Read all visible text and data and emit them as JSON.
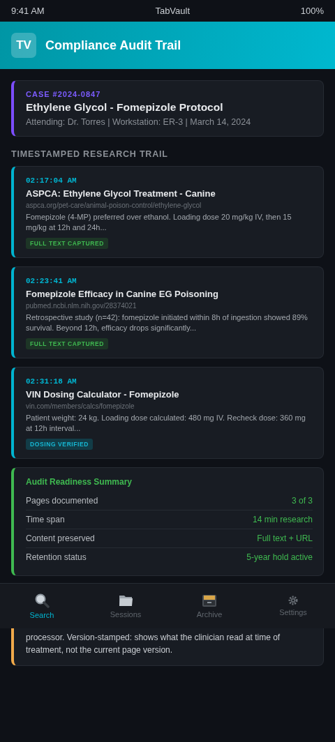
{
  "status_bar": {
    "time": "9:41 AM",
    "app": "TabVault",
    "battery": "100%"
  },
  "header": {
    "logo": "TV",
    "title": "Compliance Audit Trail"
  },
  "case": {
    "number": "CASE #2024-0847",
    "title": "Ethylene Glycol - Fomepizole Protocol",
    "meta": "Attending: Dr. Torres | Workstation: ER-3 | March 14, 2024"
  },
  "section_title": "TIMESTAMPED RESEARCH TRAIL",
  "entries": [
    {
      "time": "02:17:04 AM",
      "title": "ASPCA: Ethylene Glycol Treatment - Canine",
      "url": "aspca.org/pet-care/animal-poison-control/ethylene-glycol",
      "excerpt": "Fomepizole (4-MP) preferred over ethanol. Loading dose 20 mg/kg IV, then 15 mg/kg at 12h and 24h...",
      "badge": {
        "label": "FULL TEXT CAPTURED",
        "kind": "captured"
      }
    },
    {
      "time": "02:23:41 AM",
      "title": "Fomepizole Efficacy in Canine EG Poisoning",
      "url": "pubmed.ncbi.nlm.nih.gov/28374021",
      "excerpt": "Retrospective study (n=42): fomepizole initiated within 8h of ingestion showed 89% survival. Beyond 12h, efficacy drops significantly...",
      "badge": {
        "label": "FULL TEXT CAPTURED",
        "kind": "captured"
      }
    },
    {
      "time": "02:31:18 AM",
      "title": "VIN Dosing Calculator - Fomepizole",
      "url": "vin.com/members/calcs/fomepizole",
      "excerpt": "Patient weight: 24 kg. Loading dose calculated: 480 mg IV. Recheck dose: 360 mg at 12h interval...",
      "badge": {
        "label": "DOSING VERIFIED",
        "kind": "verified"
      }
    }
  ],
  "summary": {
    "title": "Audit Readiness Summary",
    "rows": [
      {
        "label": "Pages documented",
        "value": "3 of 3"
      },
      {
        "label": "Time span",
        "value": "14 min research"
      },
      {
        "label": "Content preserved",
        "value": "Full text + URL"
      },
      {
        "label": "Retention status",
        "value": "5-year hold active"
      }
    ]
  },
  "note": {
    "text": "processor. Version-stamped: shows what the clinician read at time of treatment, not the current page version."
  },
  "nav": [
    {
      "label": "Search",
      "selected": true
    },
    {
      "label": "Sessions",
      "selected": false
    },
    {
      "label": "Archive",
      "selected": false
    },
    {
      "label": "Settings",
      "selected": false
    }
  ]
}
